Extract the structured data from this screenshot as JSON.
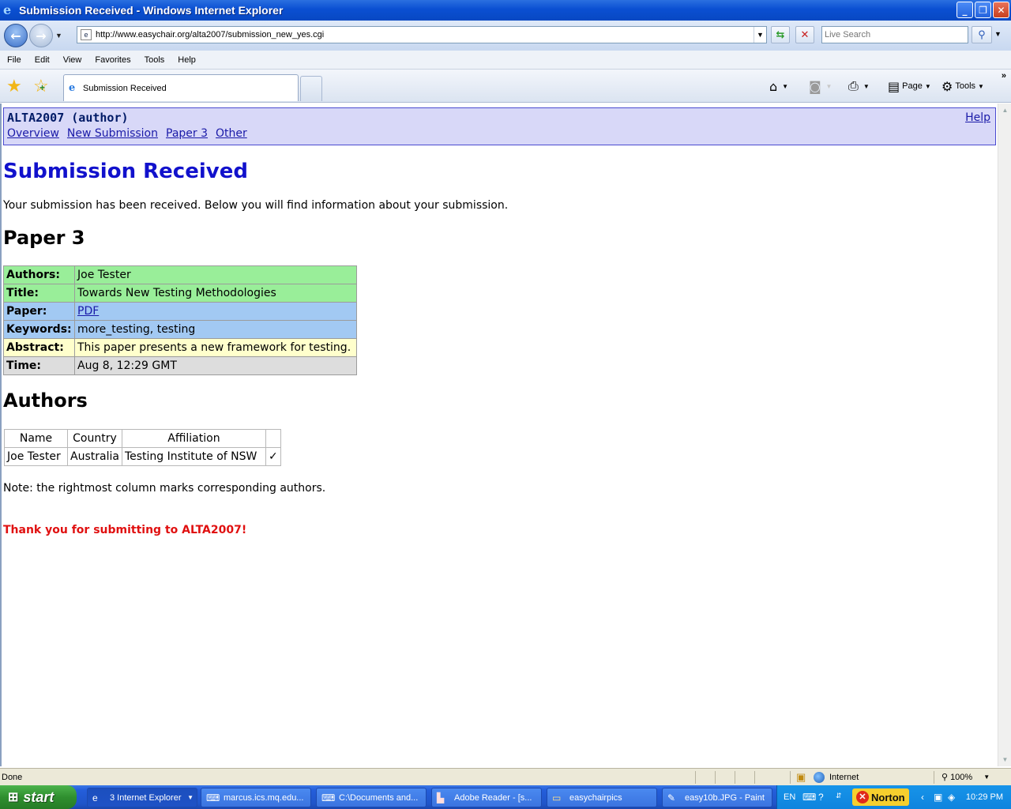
{
  "window": {
    "title": "Submission Received - Windows Internet Explorer",
    "minimize": "_",
    "maximize": "❐",
    "close": "✕"
  },
  "nav": {
    "url": "http://www.easychair.org/alta2007/submission_new_yes.cgi",
    "search_placeholder": "Live Search"
  },
  "menu": [
    "File",
    "Edit",
    "View",
    "Favorites",
    "Tools",
    "Help"
  ],
  "tabs": {
    "active_label": "Submission Received"
  },
  "commands": {
    "page_label": "Page",
    "tools_label": "Tools"
  },
  "easychair": {
    "conf_title": "ALTA2007 (author)",
    "nav_links": [
      "Overview",
      "New Submission",
      "Paper 3",
      "Other"
    ],
    "help_label": "Help"
  },
  "page": {
    "heading": "Submission Received",
    "intro": "Your submission has been received. Below you will find information about your submission.",
    "paper_heading": "Paper 3",
    "info_rows": [
      {
        "key": "Authors:",
        "value": "Joe Tester"
      },
      {
        "key": "Title:",
        "value": "Towards New Testing Methodologies"
      },
      {
        "key": "Paper:",
        "value": "PDF"
      },
      {
        "key": "Keywords:",
        "value": "more_testing, testing"
      },
      {
        "key": "Abstract:",
        "value": "This paper presents a new framework for testing."
      },
      {
        "key": "Time:",
        "value": "Aug 8, 12:29 GMT"
      }
    ],
    "authors_heading": "Authors",
    "authors_table": {
      "headers": [
        "Name",
        "Country",
        "Affiliation",
        ""
      ],
      "rows": [
        [
          "Joe Tester",
          "Australia",
          "Testing Institute of NSW",
          "✓"
        ]
      ]
    },
    "note": "Note: the rightmost column marks corresponding authors.",
    "thanks": "Thank you for submitting to ALTA2007!"
  },
  "status": {
    "text": "Done",
    "zone": "Internet",
    "zoom": "100%"
  },
  "taskbar": {
    "start": "start",
    "tasks": [
      "3 Internet Explorer",
      "marcus.ics.mq.edu...",
      "C:\\Documents and...",
      "Adobe Reader - [s...",
      "easychairpics",
      "easy10b.JPG - Paint"
    ],
    "lang": "EN",
    "norton": "Norton",
    "clock": "10:29 PM"
  },
  "colors": {
    "titlebar": "#0a4fd2",
    "heading_blue": "#1111cc",
    "thanks_red": "#e01010",
    "header_bg": "#d8d8f8"
  }
}
